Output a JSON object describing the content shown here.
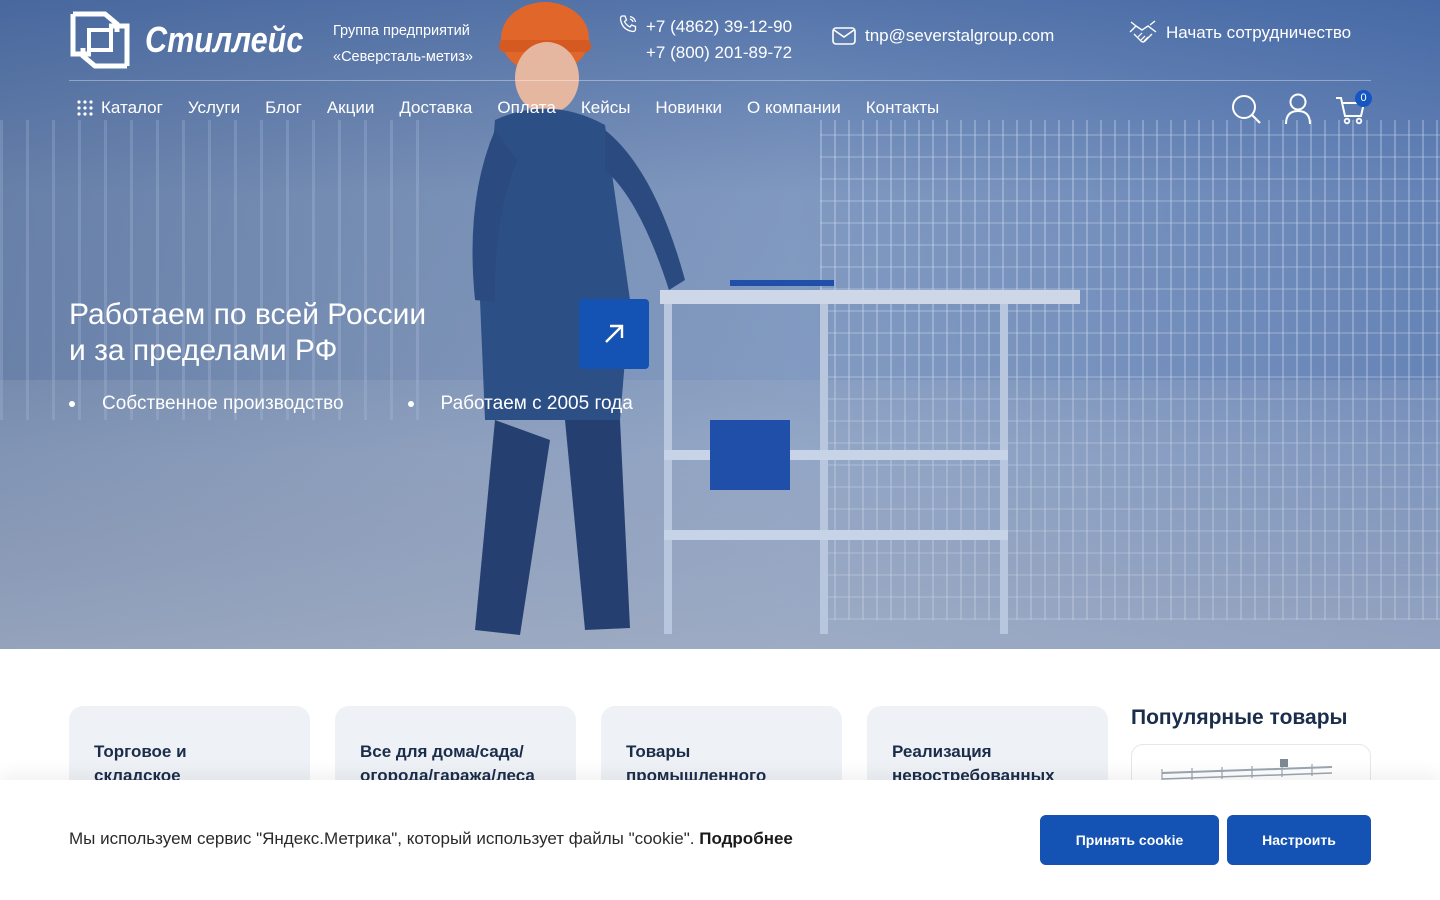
{
  "brand": {
    "logo_text": "Стиллейс",
    "group_line1": "Группа предприятий",
    "group_line2": "«Северсталь-метиз»"
  },
  "contacts": {
    "phone1": "+7 (4862) 39-12-90",
    "phone2": "+7 (800) 201-89-72",
    "email": "tnp@severstalgroup.com",
    "cooperation": "Начать сотрудничество"
  },
  "nav": {
    "catalog": "Каталог",
    "items": [
      "Услуги",
      "Блог",
      "Акции",
      "Доставка",
      "Оплата",
      "Кейсы",
      "Новинки",
      "О компании",
      "Контакты"
    ]
  },
  "cart": {
    "count": "0"
  },
  "hero": {
    "title_line1": "Работаем по всей России",
    "title_line2": "и за пределами РФ",
    "bullets": [
      "Собственное производство",
      "Работаем с 2005 года"
    ]
  },
  "categories": [
    {
      "line1": "Торговое и",
      "line2": "складское"
    },
    {
      "line1": "Все для дома/сада/",
      "line2": "огорода/гаража/леса"
    },
    {
      "line1": "Товары",
      "line2": "промышленного"
    },
    {
      "line1": "Реализация",
      "line2": "невостребованных"
    }
  ],
  "popular": {
    "title": "Популярные товары"
  },
  "cookie": {
    "text": "Мы используем сервис \"Яндекс.Метрика\", который использует файлы \"cookie\".",
    "more": "Подробнее",
    "accept": "Принять cookie",
    "settings": "Настроить"
  },
  "colors": {
    "accent": "#1452b3",
    "card_bg": "#eef1f5",
    "heading": "#1a2d4a"
  }
}
